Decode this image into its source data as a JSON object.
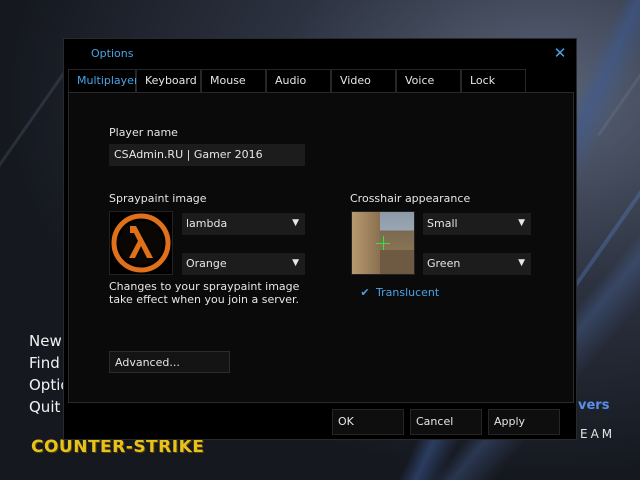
{
  "main_menu": {
    "items": [
      "New",
      "Find",
      "Optio",
      "Quit"
    ],
    "right_text_1": "vers",
    "right_text_2": "EAM",
    "logo_text": "COUNTER-STRIKE"
  },
  "window": {
    "title": "Options",
    "close_glyph": "✕",
    "tabs": [
      {
        "label": "Multiplayer",
        "active": true
      },
      {
        "label": "Keyboard",
        "active": false
      },
      {
        "label": "Mouse",
        "active": false
      },
      {
        "label": "Audio",
        "active": false
      },
      {
        "label": "Video",
        "active": false
      },
      {
        "label": "Voice",
        "active": false
      },
      {
        "label": "Lock",
        "active": false
      }
    ]
  },
  "multiplayer": {
    "player_name_label": "Player name",
    "player_name_value": "CSAdmin.RU | Gamer 2016",
    "spray_label": "Spraypaint image",
    "spray_image_dropdown": "lambda",
    "spray_color_dropdown": "Orange",
    "spray_note": "Changes to your spraypaint image take effect when you join a server.",
    "spray_logo": "λ",
    "crosshair_label": "Crosshair appearance",
    "crosshair_size_dropdown": "Small",
    "crosshair_color_dropdown": "Green",
    "translucent_label": "Translucent",
    "translucent_checked": true,
    "advanced_button": "Advanced..."
  },
  "footer": {
    "ok": "OK",
    "cancel": "Cancel",
    "apply": "Apply"
  },
  "colors": {
    "accent": "#4aa3e6",
    "logo_yellow": "#e8c21c",
    "spray_orange": "#e0701a",
    "crosshair_green": "#38e23a"
  },
  "icons": {
    "close": "close-icon",
    "dropdown": "chevron-down-icon",
    "check": "check-icon"
  }
}
